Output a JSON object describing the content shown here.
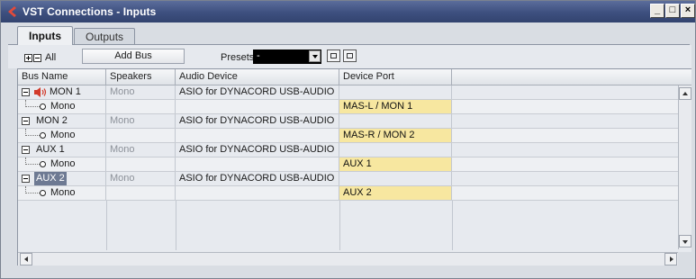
{
  "window": {
    "title": "VST Connections - Inputs",
    "minimize": "_",
    "maximize": "□",
    "close": "×"
  },
  "tabs": [
    {
      "label": "Inputs",
      "active": true
    },
    {
      "label": "Outputs",
      "active": false
    }
  ],
  "toolbar": {
    "all_label": "All",
    "add_bus_label": "Add Bus",
    "presets_label": "Presets",
    "presets_value": "-"
  },
  "columns": [
    "Bus Name",
    "Speakers",
    "Audio Device",
    "Device Port"
  ],
  "buses": [
    {
      "name": "MON 1",
      "speakers": "Mono",
      "device": "ASIO for DYNACORD USB-AUDIO",
      "channel": "Mono",
      "port": "MAS-L / MON 1",
      "has_speaker_icon": true,
      "selected": false
    },
    {
      "name": "MON 2",
      "speakers": "Mono",
      "device": "ASIO for DYNACORD USB-AUDIO",
      "channel": "Mono",
      "port": "MAS-R / MON 2",
      "has_speaker_icon": false,
      "selected": false
    },
    {
      "name": "AUX 1",
      "speakers": "Mono",
      "device": "ASIO for DYNACORD USB-AUDIO",
      "channel": "Mono",
      "port": "AUX 1",
      "has_speaker_icon": false,
      "selected": false
    },
    {
      "name": "AUX 2",
      "speakers": "Mono",
      "device": "ASIO for DYNACORD USB-AUDIO",
      "channel": "Mono",
      "port": "AUX 2",
      "has_speaker_icon": false,
      "selected": true
    }
  ],
  "colors": {
    "port_highlight": "#f7e7a0",
    "titlebar": "#3d4f7f",
    "speaker_icon": "#d23a2a",
    "selection": "#6e7a93"
  }
}
